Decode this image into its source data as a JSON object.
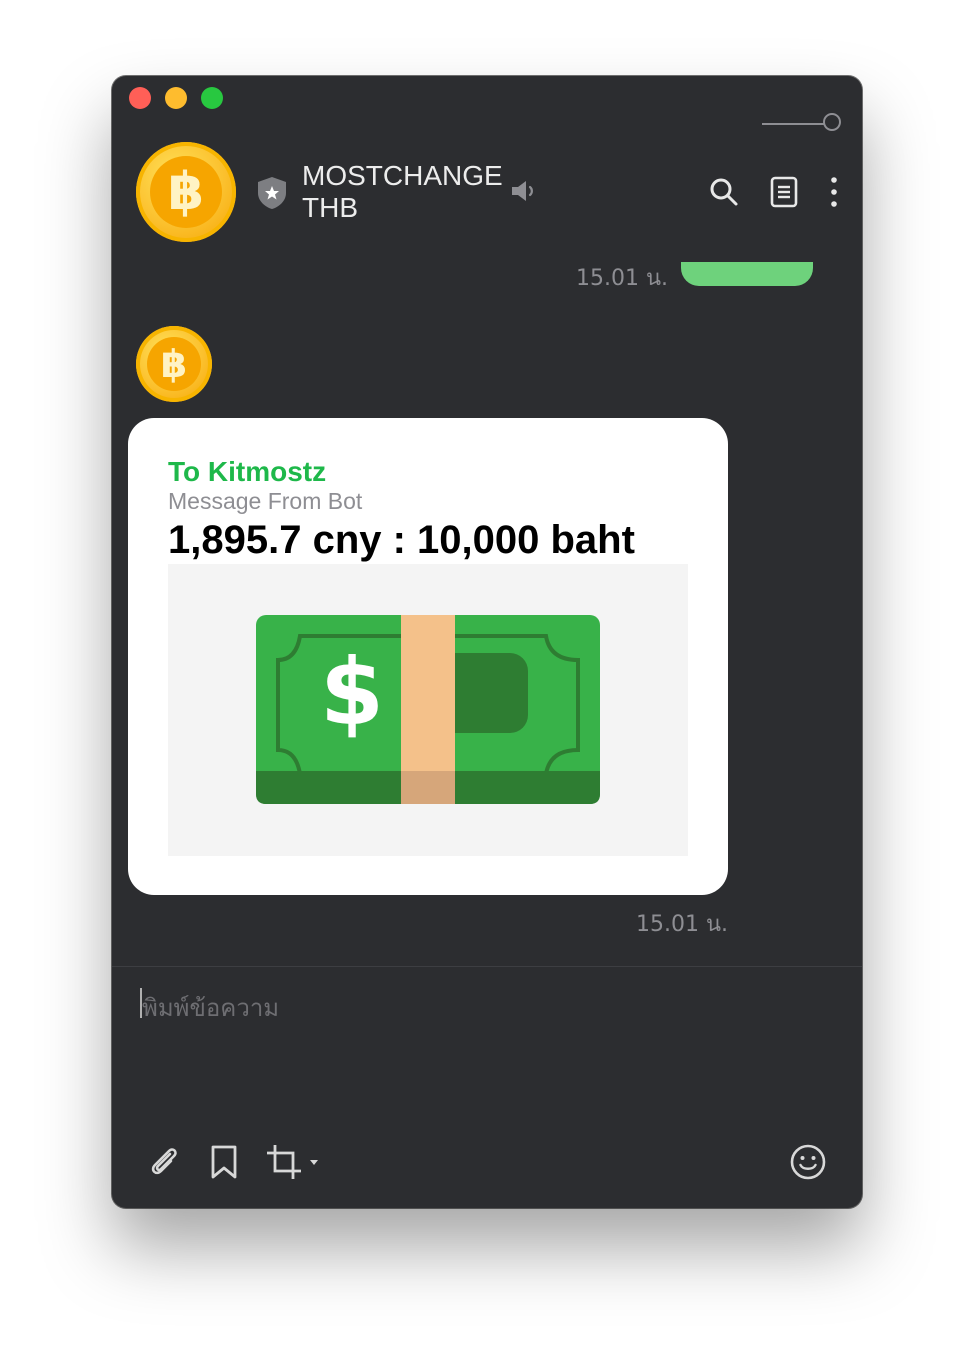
{
  "chat": {
    "name": "MOSTCHANGE THB",
    "avatar_symbol": "฿"
  },
  "messages": [
    {
      "type": "outgoing",
      "time": "15.01 น.",
      "color": "#6ed27c"
    },
    {
      "type": "incoming",
      "title": "To Kitmostz",
      "subtitle": "Message From Bot",
      "rate_text": "1,895.7 cny : 10,000 baht",
      "image_icon": "banknote-dollar-icon",
      "time": "15.01 น."
    }
  ],
  "composer": {
    "placeholder": "พิมพ์ข้อความ"
  },
  "colors": {
    "window_bg": "#2c2d30",
    "accent_green": "#1eb84a",
    "outgoing_bubble": "#6ed27c",
    "coin": "#fbc02d"
  },
  "icons": [
    "shield-star-icon",
    "speaker-icon",
    "search-icon",
    "notes-icon",
    "more-icon",
    "paperclip-icon",
    "bookmark-icon",
    "crop-icon",
    "emoji-icon"
  ]
}
